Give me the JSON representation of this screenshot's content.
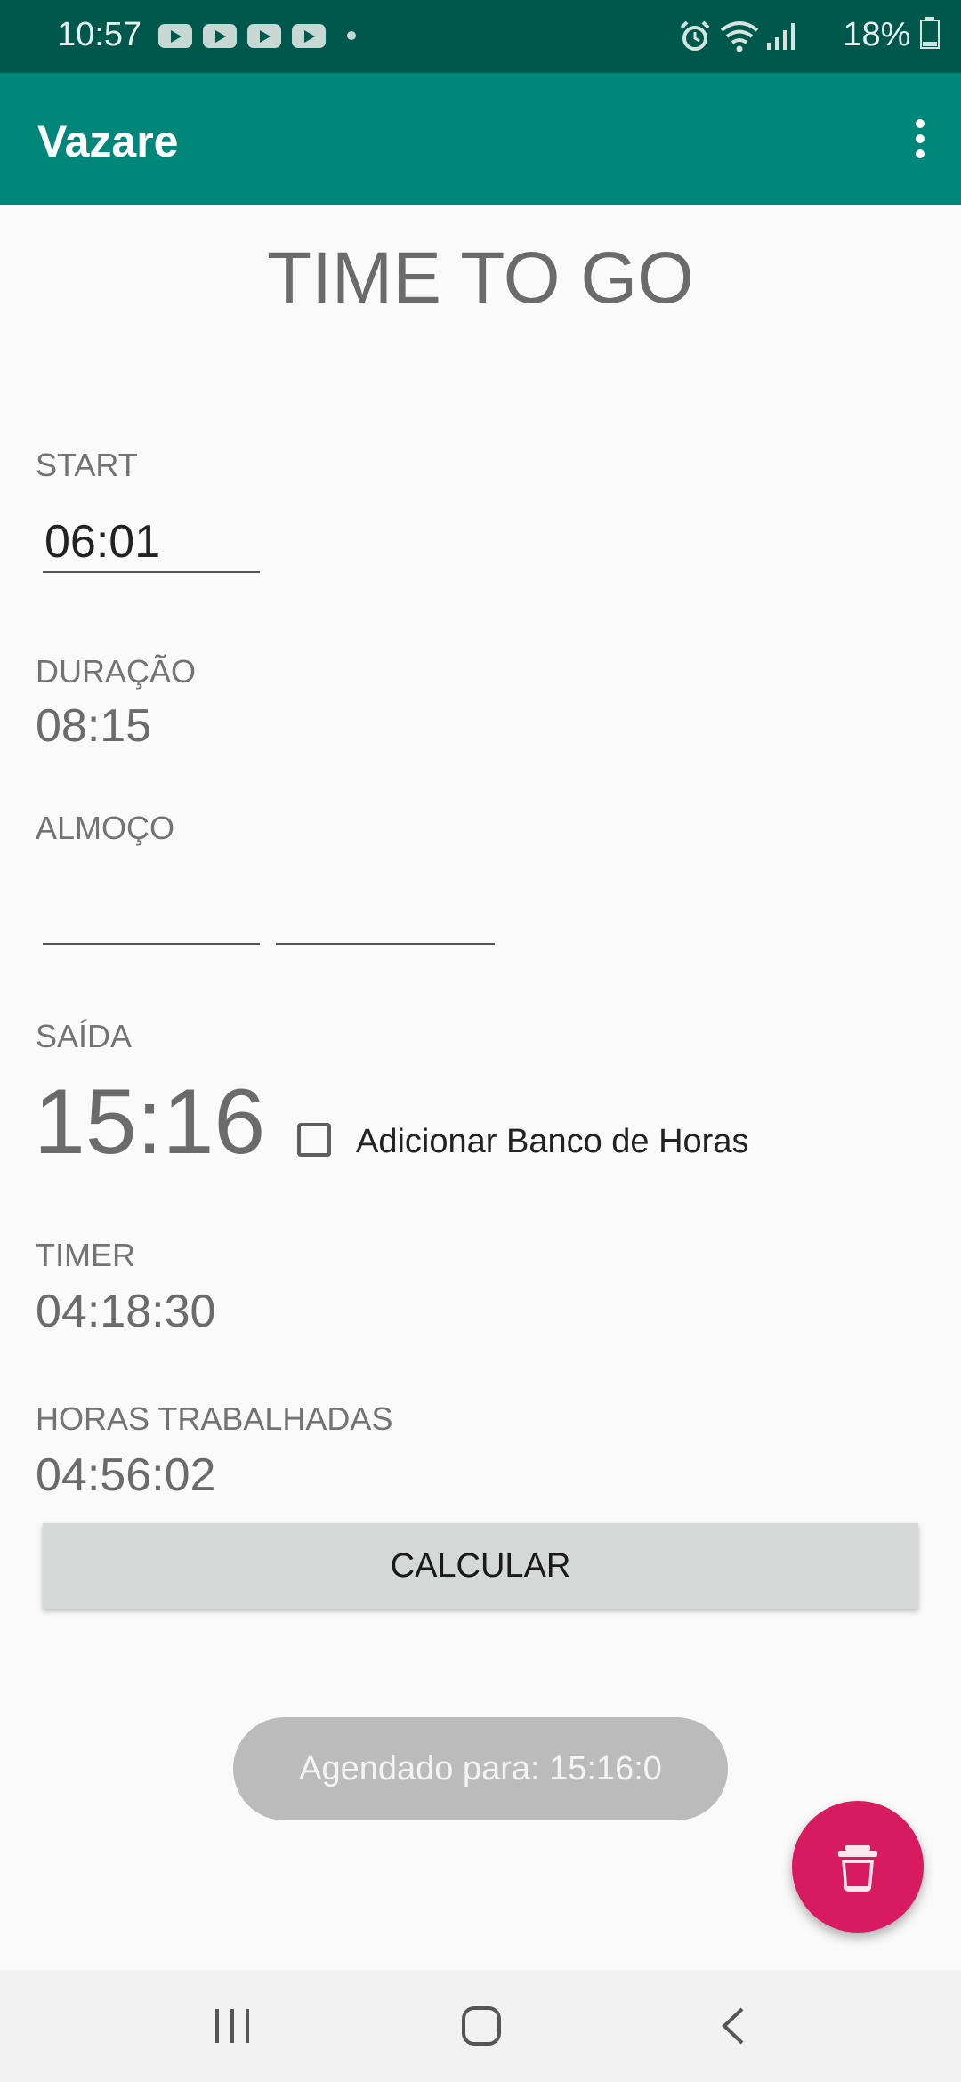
{
  "status_bar": {
    "time": "10:57",
    "battery": "18%"
  },
  "app_bar": {
    "title": "Vazare",
    "menu_icon": "more-vert-icon"
  },
  "main": {
    "title": "TIME TO GO",
    "start": {
      "label": "START",
      "value": "06:01"
    },
    "duracao": {
      "label": "DURAÇÃO",
      "value": "08:15"
    },
    "almoco": {
      "label": "ALMOÇO",
      "start_value": "",
      "end_value": ""
    },
    "saida": {
      "label": "SAÍDA",
      "value": "15:16"
    },
    "banco_horas": {
      "label": "Adicionar Banco de Horas",
      "checked": false
    },
    "timer": {
      "label": "TIMER",
      "value": "04:18:30"
    },
    "horas_trabalhadas": {
      "label": "HORAS TRABALHADAS",
      "value": "04:56:02"
    },
    "calcular_button": "CALCULAR"
  },
  "toast": {
    "text": "Agendado para: 15:16:0"
  },
  "fab": {
    "icon": "trash-icon",
    "color": "#d81b60"
  },
  "colors": {
    "status_bar": "#00574b",
    "app_bar": "#00877a",
    "accent": "#d81b60"
  }
}
